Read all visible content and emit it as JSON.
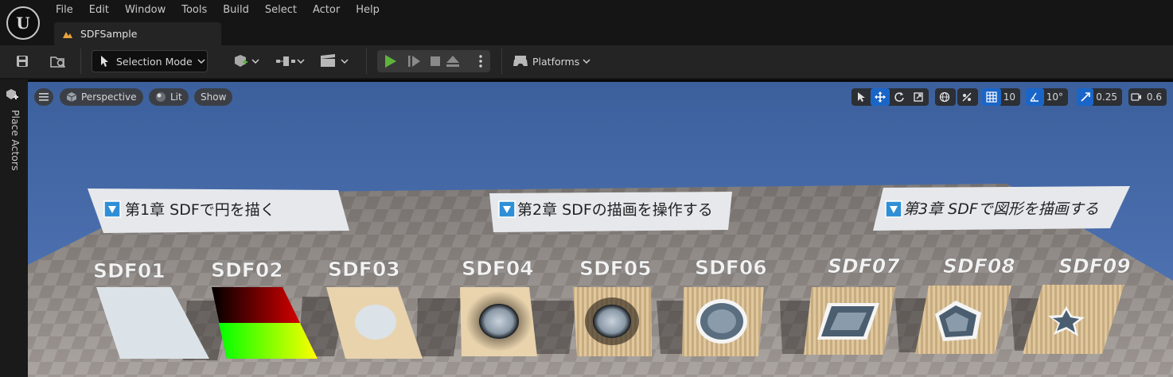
{
  "menu": [
    "File",
    "Edit",
    "Window",
    "Tools",
    "Build",
    "Select",
    "Actor",
    "Help"
  ],
  "document_tab": "SDFSample",
  "toolbar": {
    "selection_mode": "Selection Mode",
    "platforms": "Platforms"
  },
  "left_panel": {
    "place_actors": "Place Actors"
  },
  "viewport": {
    "perspective": "Perspective",
    "lit": "Lit",
    "show": "Show",
    "grid_snap": "10",
    "rotation_snap": "10°",
    "scale_snap": "0.25",
    "camera_speed": "0.6"
  },
  "scene": {
    "chapters": [
      "第1章 SDFで円を描く",
      "第2章 SDFの描画を操作する",
      "第3章 SDFで図形を描画する"
    ],
    "samples": [
      "SDF01",
      "SDF02",
      "SDF03",
      "SDF04",
      "SDF05",
      "SDF06",
      "SDF07",
      "SDF08",
      "SDF09"
    ]
  },
  "colors": {
    "accent_blue": "#1a66c8",
    "play_green": "#5fb33a",
    "sky": "#4b6fae",
    "card": "#e8d3ad"
  }
}
